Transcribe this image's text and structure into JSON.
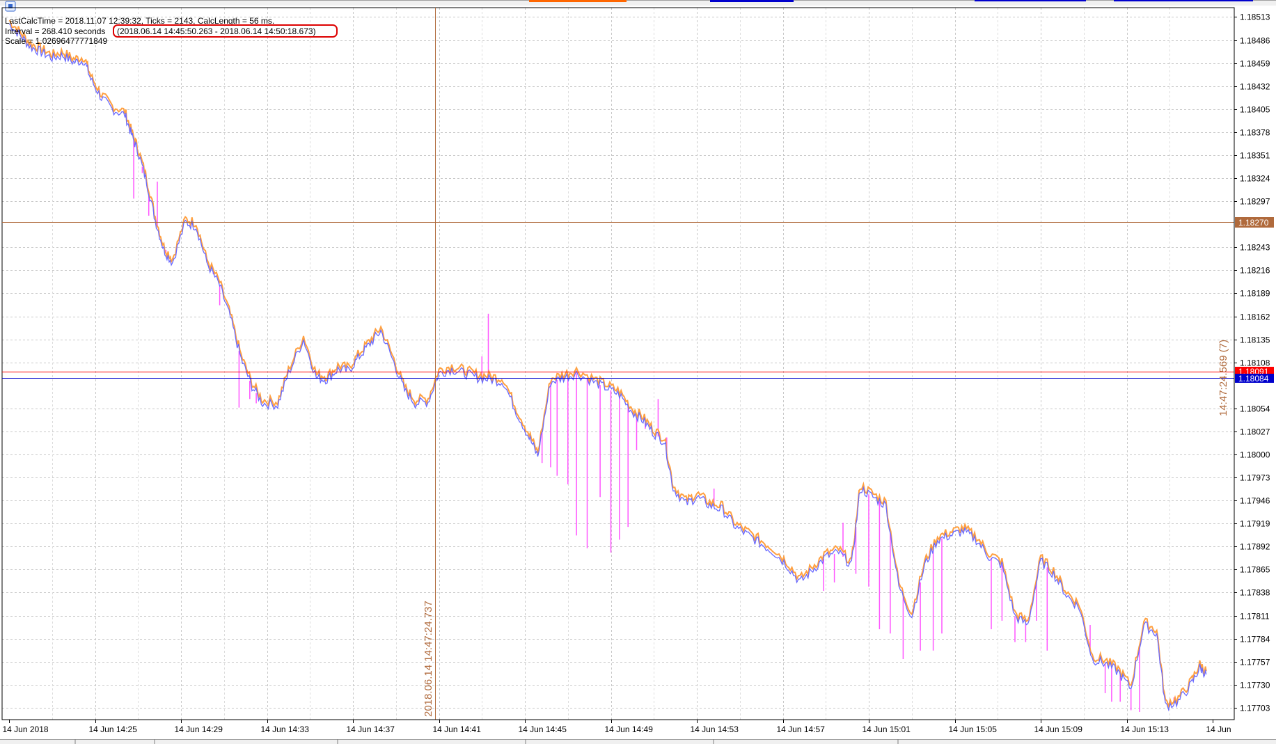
{
  "info": {
    "line1": "LastCalcTime = 2018.11.07 12:39:32, Ticks = 2143, CalcLength = 56 ms.",
    "line2_prefix": "Interval = 268.410 seconds ",
    "line2_range": "(2018.06.14 14:45:50.263 - 2018.06.14 14:50:18.673)",
    "line3": "Scale = 1.02696477771849"
  },
  "crosshair": {
    "time_label": "2018.06.14 14:47:24.737",
    "price_label": "1.18270",
    "right_label": "14:47:24.569 (7)"
  },
  "lines": {
    "red_price": "1.18091",
    "blue_price": "1.18084"
  },
  "colors": {
    "bid": "#6a6aff",
    "ask": "#ffa040",
    "spike": "#ff55ff",
    "grid": "#c8c8c8",
    "crosshair": "#b06a3c",
    "red_line": "#ff0000",
    "blue_line": "#0000cc"
  },
  "chart_data": {
    "type": "line",
    "y_ticks": [
      "1.18513",
      "1.18486",
      "1.18459",
      "1.18432",
      "1.18405",
      "1.18378",
      "1.18351",
      "1.18324",
      "1.18297",
      "1.18243",
      "1.18216",
      "1.18189",
      "1.18162",
      "1.18135",
      "1.18108",
      "1.18054",
      "1.18027",
      "1.18000",
      "1.17973",
      "1.17946",
      "1.17919",
      "1.17892",
      "1.17865",
      "1.17838",
      "1.17811",
      "1.17784",
      "1.17757",
      "1.17730",
      "1.17703"
    ],
    "x_ticks": [
      "14 Jun 2018",
      "14 Jun 14:25",
      "14 Jun 14:29",
      "14 Jun 14:33",
      "14 Jun 14:37",
      "14 Jun 14:41",
      "14 Jun 14:45",
      "14 Jun 14:49",
      "14 Jun 14:53",
      "14 Jun 14:57",
      "14 Jun 15:01",
      "14 Jun 15:05",
      "14 Jun 15:09",
      "14 Jun 15:13",
      "14 Jun"
    ],
    "ylim": [
      1.17689,
      1.18524
    ],
    "x_range_minutes": [
      0,
      56
    ],
    "series": [
      {
        "role": "bid",
        "points": [
          [
            0.0,
            1.18505
          ],
          [
            0.5,
            1.18492
          ],
          [
            1.0,
            1.18478
          ],
          [
            1.5,
            1.18472
          ],
          [
            2.0,
            1.18465
          ],
          [
            2.5,
            1.18468
          ],
          [
            3.0,
            1.1846
          ],
          [
            3.5,
            1.18462
          ],
          [
            3.8,
            1.1844
          ],
          [
            4.3,
            1.18418
          ],
          [
            4.8,
            1.18405
          ],
          [
            5.4,
            1.18398
          ],
          [
            5.7,
            1.18375
          ],
          [
            6.0,
            1.18355
          ],
          [
            6.4,
            1.1832
          ],
          [
            6.8,
            1.18275
          ],
          [
            7.2,
            1.1824
          ],
          [
            7.6,
            1.18225
          ],
          [
            8.2,
            1.18272
          ],
          [
            8.7,
            1.18268
          ],
          [
            9.2,
            1.18225
          ],
          [
            9.8,
            1.18198
          ],
          [
            10.3,
            1.1816
          ],
          [
            10.8,
            1.18112
          ],
          [
            11.3,
            1.1808
          ],
          [
            11.8,
            1.1806
          ],
          [
            12.5,
            1.18058
          ],
          [
            13.0,
            1.18095
          ],
          [
            13.7,
            1.18135
          ],
          [
            14.3,
            1.1809
          ],
          [
            14.8,
            1.18088
          ],
          [
            15.3,
            1.181
          ],
          [
            15.8,
            1.18098
          ],
          [
            16.3,
            1.18115
          ],
          [
            16.8,
            1.1813
          ],
          [
            17.3,
            1.18145
          ],
          [
            17.9,
            1.18108
          ],
          [
            18.4,
            1.18075
          ],
          [
            18.9,
            1.1806
          ],
          [
            19.5,
            1.18062
          ],
          [
            20.0,
            1.18095
          ],
          [
            20.6,
            1.181
          ],
          [
            21.2,
            1.18095
          ],
          [
            21.8,
            1.1809
          ],
          [
            22.4,
            1.18088
          ],
          [
            23.0,
            1.18085
          ],
          [
            23.6,
            1.1805
          ],
          [
            24.2,
            1.1802
          ],
          [
            24.6,
            1.17998
          ],
          [
            25.2,
            1.18085
          ],
          [
            25.8,
            1.1809
          ],
          [
            26.4,
            1.18095
          ],
          [
            27.2,
            1.18085
          ],
          [
            27.8,
            1.18078
          ],
          [
            28.4,
            1.1807
          ],
          [
            29.0,
            1.1805
          ],
          [
            29.5,
            1.1804
          ],
          [
            30.0,
            1.18025
          ],
          [
            30.5,
            1.18015
          ],
          [
            30.9,
            1.1796
          ],
          [
            31.5,
            1.17942
          ],
          [
            32.0,
            1.1795
          ],
          [
            32.6,
            1.1794
          ],
          [
            33.2,
            1.17935
          ],
          [
            33.8,
            1.17915
          ],
          [
            34.4,
            1.17905
          ],
          [
            35.0,
            1.17895
          ],
          [
            35.6,
            1.17885
          ],
          [
            36.2,
            1.1787
          ],
          [
            36.8,
            1.1785
          ],
          [
            37.4,
            1.17865
          ],
          [
            38.0,
            1.1788
          ],
          [
            38.6,
            1.17885
          ],
          [
            39.2,
            1.1787
          ],
          [
            39.6,
            1.1796
          ],
          [
            40.2,
            1.1795
          ],
          [
            40.8,
            1.1794
          ],
          [
            41.4,
            1.17845
          ],
          [
            42.0,
            1.1781
          ],
          [
            42.6,
            1.1787
          ],
          [
            43.2,
            1.179
          ],
          [
            43.8,
            1.17905
          ],
          [
            44.4,
            1.1791
          ],
          [
            45.0,
            1.179
          ],
          [
            45.6,
            1.1788
          ],
          [
            46.2,
            1.1787
          ],
          [
            46.8,
            1.1781
          ],
          [
            47.4,
            1.178
          ],
          [
            48.0,
            1.17875
          ],
          [
            48.6,
            1.1786
          ],
          [
            49.2,
            1.17835
          ],
          [
            49.8,
            1.1782
          ],
          [
            50.4,
            1.1776
          ],
          [
            51.0,
            1.17755
          ],
          [
            51.6,
            1.17745
          ],
          [
            52.2,
            1.17725
          ],
          [
            52.8,
            1.178
          ],
          [
            53.4,
            1.1779
          ],
          [
            53.8,
            1.17705
          ],
          [
            54.4,
            1.1771
          ],
          [
            55.0,
            1.1773
          ],
          [
            55.4,
            1.1775
          ],
          [
            55.7,
            1.17742
          ]
        ]
      },
      {
        "role": "spikes",
        "points": [
          [
            5.8,
            1.183
          ],
          [
            6.2,
            1.1833
          ],
          [
            6.5,
            1.1828
          ],
          [
            6.9,
            1.1832
          ],
          [
            7.3,
            1.1824
          ],
          [
            9.5,
            1.18215
          ],
          [
            9.8,
            1.18175
          ],
          [
            10.7,
            1.18055
          ],
          [
            11.2,
            1.18065
          ],
          [
            11.5,
            1.1806
          ],
          [
            22.0,
            1.18115
          ],
          [
            22.3,
            1.18165
          ],
          [
            24.8,
            1.1799
          ],
          [
            25.2,
            1.17985
          ],
          [
            25.5,
            1.17975
          ],
          [
            26.0,
            1.17965
          ],
          [
            26.4,
            1.17905
          ],
          [
            26.9,
            1.1789
          ],
          [
            27.5,
            1.1795
          ],
          [
            28.0,
            1.17885
          ],
          [
            28.4,
            1.179
          ],
          [
            28.8,
            1.17915
          ],
          [
            29.2,
            1.18005
          ],
          [
            29.6,
            1.1803
          ],
          [
            30.2,
            1.18065
          ],
          [
            30.6,
            1.1802
          ],
          [
            32.4,
            1.17945
          ],
          [
            32.8,
            1.1796
          ],
          [
            37.9,
            1.1784
          ],
          [
            38.4,
            1.1785
          ],
          [
            38.8,
            1.1792
          ],
          [
            39.4,
            1.1786
          ],
          [
            40.0,
            1.17845
          ],
          [
            40.5,
            1.17795
          ],
          [
            41.0,
            1.1779
          ],
          [
            41.6,
            1.1776
          ],
          [
            42.4,
            1.1777
          ],
          [
            43.0,
            1.1777
          ],
          [
            43.4,
            1.1779
          ],
          [
            45.7,
            1.17795
          ],
          [
            46.2,
            1.17805
          ],
          [
            46.8,
            1.1778
          ],
          [
            47.3,
            1.1778
          ],
          [
            47.8,
            1.17805
          ],
          [
            48.3,
            1.1777
          ],
          [
            50.3,
            1.178
          ],
          [
            51.0,
            1.1772
          ],
          [
            51.3,
            1.1771
          ],
          [
            51.7,
            1.1771
          ],
          [
            52.2,
            1.177
          ],
          [
            52.6,
            1.17698
          ],
          [
            54.2,
            1.17715
          ]
        ]
      }
    ]
  }
}
